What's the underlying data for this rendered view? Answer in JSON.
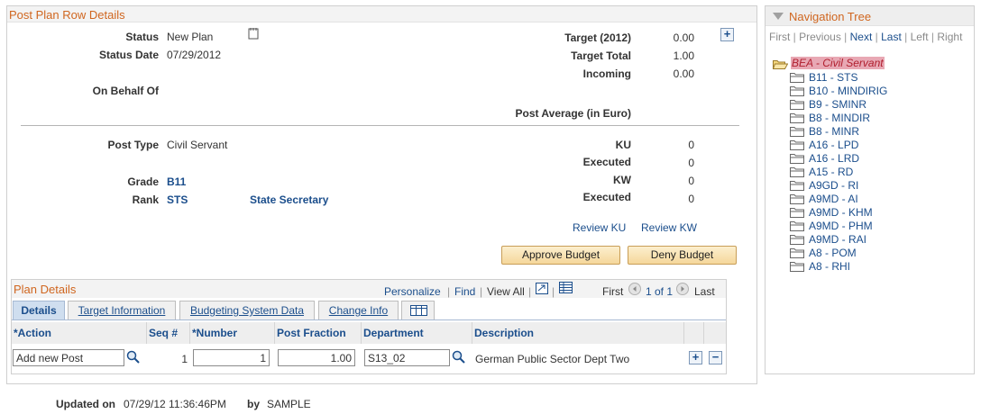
{
  "post": {
    "title": "Post Plan Row Details",
    "status_label": "Status",
    "status_value": "New Plan",
    "status_date_label": "Status Date",
    "status_date_value": "07/29/2012",
    "on_behalf_label": "On Behalf Of",
    "target_label": "Target (2012)",
    "target_value": "0.00",
    "target_total_label": "Target Total",
    "target_total_value": "1.00",
    "incoming_label": "Incoming",
    "incoming_value": "0.00",
    "post_average_label": "Post Average (in Euro)",
    "post_type_label": "Post Type",
    "post_type_value": "Civil Servant",
    "grade_label": "Grade",
    "grade_value": "B11",
    "rank_label": "Rank",
    "rank_value": "STS",
    "rank_desc": "State Secretary",
    "ku_label": "KU",
    "ku_value": "0",
    "ku_executed_label": "Executed",
    "ku_executed_value": "0",
    "kw_label": "KW",
    "kw_value": "0",
    "kw_executed_label": "Executed",
    "kw_executed_value": "0",
    "review_ku": "Review KU",
    "review_kw": "Review KW",
    "approve_button": "Approve Budget",
    "deny_button": "Deny Budget"
  },
  "plan": {
    "title": "Plan Details",
    "personalize": "Personalize",
    "find": "Find",
    "view_all": "View All",
    "first": "First",
    "range": "1 of 1",
    "last": "Last",
    "tabs": [
      "Details",
      "Target Information",
      "Budgeting System Data",
      "Change Info"
    ],
    "columns": [
      "*Action",
      "Seq #",
      "*Number",
      "Post Fraction",
      "Department",
      "Description"
    ],
    "row": {
      "action": "Add new Post",
      "seq": "1",
      "number": "1",
      "post_fraction": "1.00",
      "department": "S13_02",
      "description": "German Public Sector Dept Two"
    }
  },
  "footer": {
    "updated_on_label": "Updated on",
    "updated_on_value": "07/29/12 11:36:46PM",
    "by_label": "by",
    "by_value": "SAMPLE"
  },
  "nav": {
    "title": "Navigation Tree",
    "controls": [
      "First",
      "Previous",
      "Next",
      "Last",
      "Left",
      "Right"
    ],
    "root": "BEA - Civil Servant",
    "items": [
      "B11 - STS",
      "B10 - MINDIRIG",
      "B9 - SMINR",
      "B8 - MINDIR",
      "B8 - MINR",
      "A16 - LPD",
      "A16 - LRD",
      "A15 - RD",
      "A9GD - RI",
      "A9MD - AI",
      "A9MD - KHM",
      "A9MD - PHM",
      "A9MD - RAI",
      "A8 - POM",
      "A8 - RHI"
    ]
  },
  "colors": {
    "accent": "#d0661f",
    "link": "#1b4e8c",
    "button_bg": "#f5d79b",
    "root_highlight": "#e8a8b4"
  },
  "icons": [
    "notepad-icon",
    "plus-icon",
    "minus-icon",
    "search-icon",
    "download-icon",
    "grid-icon",
    "chevron-left-icon",
    "chevron-right-icon",
    "folder-icon",
    "folder-open-icon",
    "triangle-down-icon"
  ]
}
